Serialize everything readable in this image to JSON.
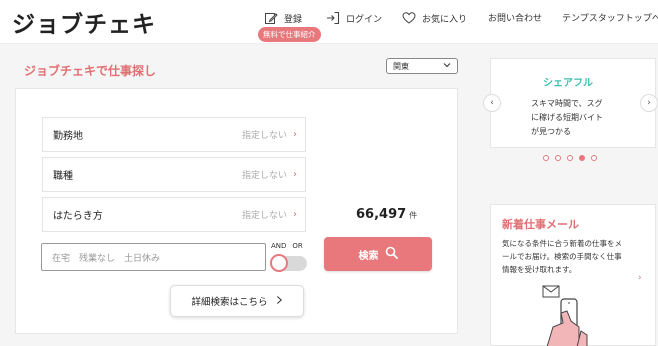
{
  "header": {
    "logo": "ジョブチェキ",
    "nav": {
      "register": "登録",
      "login": "ログイン",
      "favorites": "お気に入り",
      "contact": "お問い合わせ",
      "staff_top": "テンプスタッフトップへ"
    },
    "register_badge": "無料で仕事紹介",
    "icons": [
      "edit-icon",
      "login-icon",
      "heart-icon"
    ]
  },
  "main": {
    "title": "ジョブチェキで仕事探し",
    "area_select": "関東",
    "filters": [
      {
        "label": "勤務地",
        "hint": "指定しない"
      },
      {
        "label": "職種",
        "hint": "指定しない"
      },
      {
        "label": "はたらき方",
        "hint": "指定しない"
      }
    ],
    "count": "66,497",
    "count_unit": "件",
    "keyword_placeholder": "在宅　残業なし　土日休み",
    "and_label": "AND",
    "or_label": "OR",
    "search_label": "検索",
    "detail_label": "詳細検索はこちら"
  },
  "sidebar": {
    "ad": {
      "title": "シェアフル",
      "line1": "スキマ時間で、スグ",
      "line2": "に稼げる短期バイト",
      "line3": "が見つかる"
    },
    "carousel_dots": 5,
    "carousel_active": 3,
    "mail": {
      "title": "新着仕事メール",
      "line1": "気になる条件に合う新着の仕事をメ",
      "line2": "ールでお届け。検索の手間なく仕事",
      "line3": "情報を受け取れます。"
    }
  },
  "colors": {
    "accent": "#e8787c",
    "teal": "#3bbfae"
  }
}
